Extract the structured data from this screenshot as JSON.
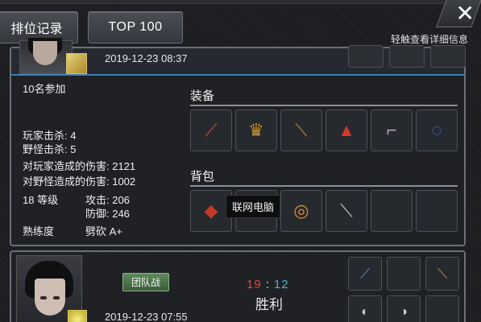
{
  "tabs": {
    "records": "排位记录",
    "top100": "TOP 100"
  },
  "close_glyph": "✕",
  "hint": "轻触查看详细信息",
  "match1": {
    "date": "2019-12-23 08:37",
    "participants": "10名参加",
    "stats": {
      "player_kills": "玩家击杀: 4",
      "monster_kills": "野怪击杀: 5",
      "player_damage": "对玩家造成的伤害: 2121",
      "monster_damage": "对野怪造成的伤害: 1002",
      "level": "18 等级",
      "attack": "攻击: 206",
      "defense": "防御: 246",
      "proficiency_label": "熟练度",
      "proficiency_value": "劈砍 A+"
    },
    "equipment_title": "装备",
    "bag_title": "背包",
    "equipment": [
      {
        "icon": "sword-icon",
        "glyph": "⟋",
        "color": "#d24a3a"
      },
      {
        "icon": "crown-icon",
        "glyph": "♛",
        "color": "#c9932c"
      },
      {
        "icon": "stick-icon",
        "glyph": "⟍",
        "color": "#b58b3a"
      },
      {
        "icon": "armor-icon",
        "glyph": "▲",
        "color": "#d23a2a"
      },
      {
        "icon": "boots-icon",
        "glyph": "⌐",
        "color": "#b8a0b8"
      },
      {
        "icon": "belt-icon",
        "glyph": "◌",
        "color": "#4a7ad8"
      }
    ],
    "bag": [
      {
        "icon": "meat-icon",
        "glyph": "◆",
        "color": "#c43a2a"
      },
      {
        "icon": "blade-icon",
        "glyph": "⟋",
        "color": "#8a8fa0"
      },
      {
        "icon": "ring-icon",
        "glyph": "◎",
        "color": "#e08a2a"
      },
      {
        "icon": "bandage-icon",
        "glyph": "⟍",
        "color": "#c8c8c8"
      },
      {
        "icon": "",
        "glyph": "",
        "color": ""
      },
      {
        "icon": "",
        "glyph": "",
        "color": ""
      }
    ],
    "tooltip": "联网电脑"
  },
  "match2": {
    "mode": "团队战",
    "score_left": "19",
    "score_sep": ":",
    "score_right": "12",
    "result": "胜利",
    "date": "2019-12-23 07:55"
  },
  "colors": {
    "accent_blue": "#3f7fb8",
    "score_red": "#e0473f",
    "score_blue": "#47b6d8"
  }
}
